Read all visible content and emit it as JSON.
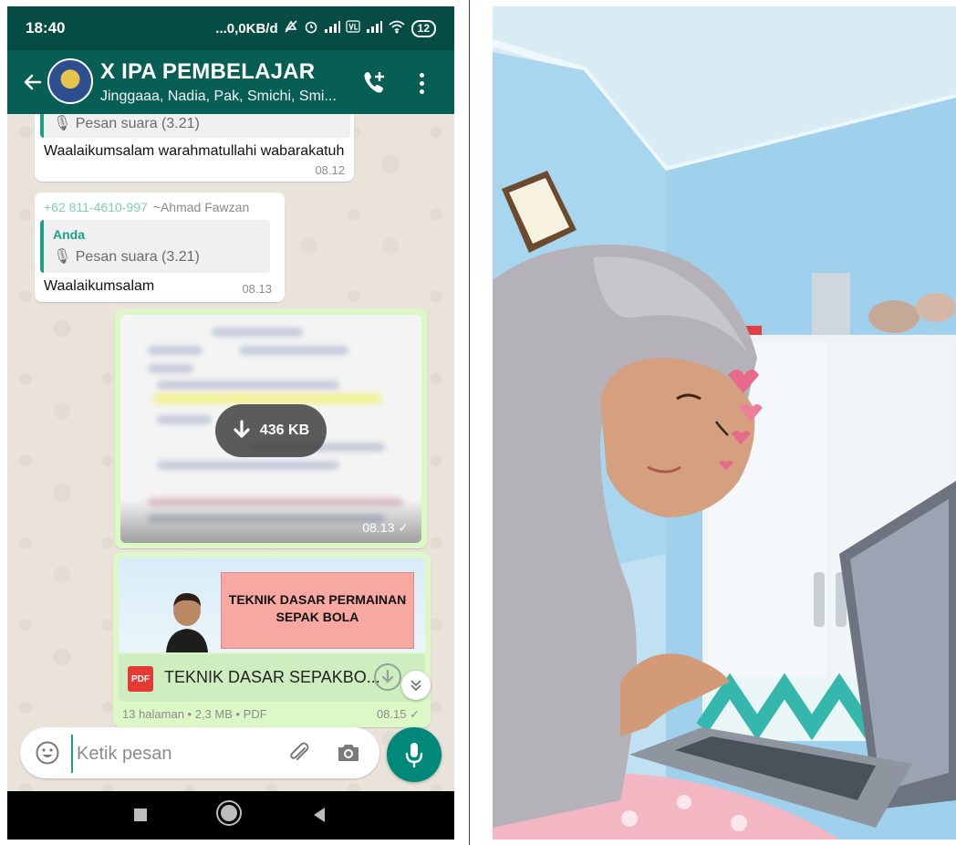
{
  "status_bar": {
    "time": "18:40",
    "network_speed": "...0,0KB/d",
    "battery": "12"
  },
  "app_bar": {
    "title": "X IPA PEMBELAJAR",
    "members": "Jinggaaa, Nadia, Pak, Smichi, Smi..."
  },
  "messages": [
    {
      "quote_text": "🎙 Pesan suara (3.21)",
      "text": "Waalaikumsalam warahmatullahi wabarakatuh",
      "time": "08.12"
    },
    {
      "sender_number": "+62 811-4610-997",
      "sender_alias": "~Ahmad Fawzan",
      "quote_name": "Anda",
      "quote_text": "🎙 Pesan suara (3.21)",
      "text": "Waalaikumsalam",
      "time": "08.13"
    }
  ],
  "image_message": {
    "size": "436 KB",
    "time": "08.13 ✓"
  },
  "document_message": {
    "preview_title": "TEKNIK DASAR PERMAINAN SEPAK BOLA",
    "file_badge": "PDF",
    "file_name": "TEKNIK DASAR SEPAKBO...",
    "info": "13 halaman • 2,3 MB • PDF",
    "time": "08.15 ✓"
  },
  "composer": {
    "placeholder": "Ketik pesan"
  },
  "colors": {
    "header": "#075e54",
    "status_bar": "#054d44",
    "outgoing_bubble": "#dcf8c6",
    "accent": "#00897b"
  }
}
